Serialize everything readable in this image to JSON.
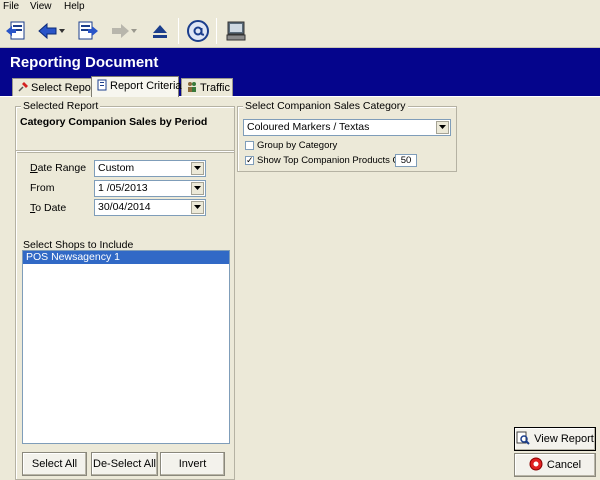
{
  "menu": {
    "file": "File",
    "view": "View",
    "help": "Help"
  },
  "window": {
    "title": "Reporting Document"
  },
  "tabs": [
    {
      "label": "Select Report"
    },
    {
      "label": "Report Criteria"
    },
    {
      "label": "Traffic"
    }
  ],
  "selected_report": {
    "group_title": "Selected Report",
    "name": "Category Companion Sales by Period"
  },
  "criteria": {
    "date_range_label": "Date Range",
    "date_range_value": "Custom",
    "from_label": "From",
    "from_value": "1 /05/2013",
    "to_label": "To Date",
    "to_value": "30/04/2014",
    "shops_label": "Select Shops to Include",
    "shops": [
      "POS Newsagency 1"
    ],
    "select_all": "Select All",
    "deselect_all": "De-Select All",
    "invert": "Invert"
  },
  "companion": {
    "group_title": "Select Companion Sales Category",
    "category_value": "Coloured Markers / Textas",
    "group_by_label": "Group by Category",
    "group_by_checked": false,
    "show_top_label": "Show Top Companion Products Only",
    "show_top_checked": true,
    "top_count": "50"
  },
  "actions": {
    "view_report": "View Report",
    "cancel": "Cancel"
  },
  "colors": {
    "title_bar": "#05058c",
    "selection": "#3169c6",
    "window_bg": "#ece9d8"
  }
}
